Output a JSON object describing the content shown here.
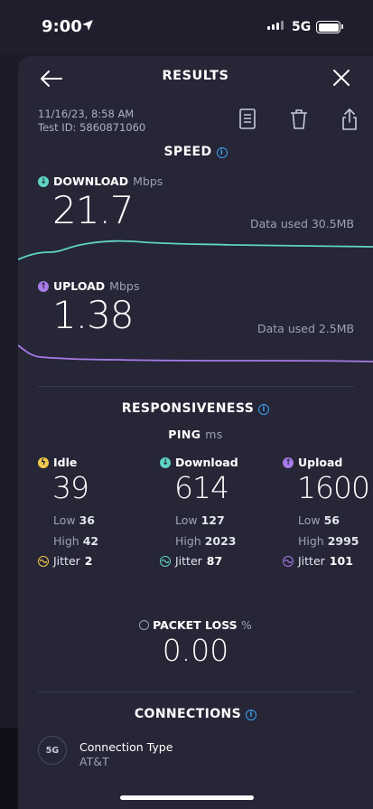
{
  "status_bar": {
    "time": "9:00",
    "network": "5G"
  },
  "header": {
    "title": "RESULTS"
  },
  "meta": {
    "date": "11/16/23, 8:58 AM",
    "test_id": "Test ID: 5860871060"
  },
  "speed": {
    "title": "SPEED",
    "download": {
      "label": "DOWNLOAD",
      "unit": "Mbps",
      "value": "21.7",
      "data_used": "Data used 30.5MB"
    },
    "upload": {
      "label": "UPLOAD",
      "unit": "Mbps",
      "value": "1.38",
      "data_used": "Data used 2.5MB"
    }
  },
  "responsiveness": {
    "title": "RESPONSIVENESS",
    "ping_label": "PING",
    "ping_unit": "ms",
    "columns": [
      {
        "label": "Idle",
        "value": "39",
        "low_label": "Low",
        "low": "36",
        "high_label": "High",
        "high": "42",
        "jitter_label": "Jitter",
        "jitter": "2"
      },
      {
        "label": "Download",
        "value": "614",
        "low_label": "Low",
        "low": "127",
        "high_label": "High",
        "high": "2023",
        "jitter_label": "Jitter",
        "jitter": "87"
      },
      {
        "label": "Upload",
        "value": "1600",
        "low_label": "Low",
        "low": "56",
        "high_label": "High",
        "high": "2995",
        "jitter_label": "Jitter",
        "jitter": "101"
      }
    ]
  },
  "packet_loss": {
    "label": "PACKET LOSS",
    "unit": "%",
    "value": "0.00"
  },
  "connections": {
    "title": "CONNECTIONS",
    "badge": "5G",
    "type_label": "Connection Type",
    "type_value": "AT&T"
  },
  "colors": {
    "download": "#5fd3c4",
    "upload": "#a77be8",
    "idle": "#f2c94c",
    "info": "#3a9ff0"
  },
  "icons": {
    "back": "arrow-left-icon",
    "close": "close-icon",
    "report": "document-icon",
    "delete": "trash-icon",
    "share": "share-icon"
  }
}
